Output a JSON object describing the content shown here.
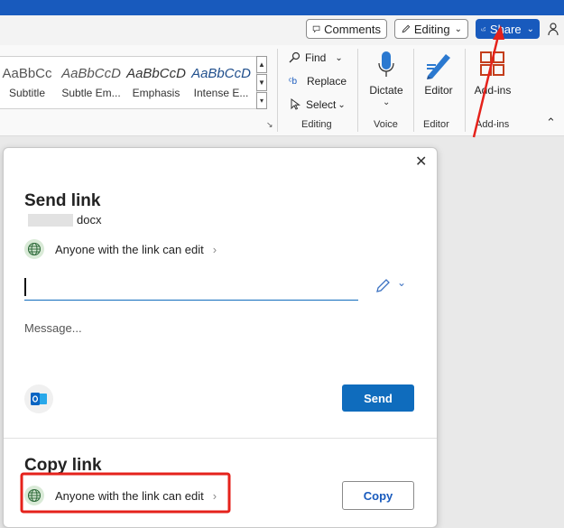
{
  "header": {
    "comments_label": "Comments",
    "editing_label": "Editing",
    "share_label": "Share"
  },
  "ribbon": {
    "styles": [
      {
        "sample": "AaBbCc",
        "name": "Subtitle"
      },
      {
        "sample": "AaBbCcD",
        "name": "Subtle Em..."
      },
      {
        "sample": "AaBbCcD",
        "name": "Emphasis"
      },
      {
        "sample": "AaBbCcD",
        "name": "Intense E..."
      }
    ],
    "find_label": "Find",
    "replace_label": "Replace",
    "select_label": "Select",
    "editing_group": "Editing",
    "dictate_label": "Dictate",
    "voice_group": "Voice",
    "editor_label": "Editor",
    "editor_group": "Editor",
    "addins_label": "Add-ins",
    "addins_group": "Add-ins"
  },
  "dialog": {
    "send_title": "Send link",
    "file_name": "docx",
    "permission_text": "Anyone with the link can edit",
    "message_placeholder": "Message...",
    "send_label": "Send",
    "copy_title": "Copy link",
    "copy_permission_text": "Anyone with the link can edit",
    "copy_label": "Copy"
  },
  "colors": {
    "brand_blue": "#185abd",
    "primary_button": "#0f6cbd",
    "annotation_red": "#e5221b"
  }
}
